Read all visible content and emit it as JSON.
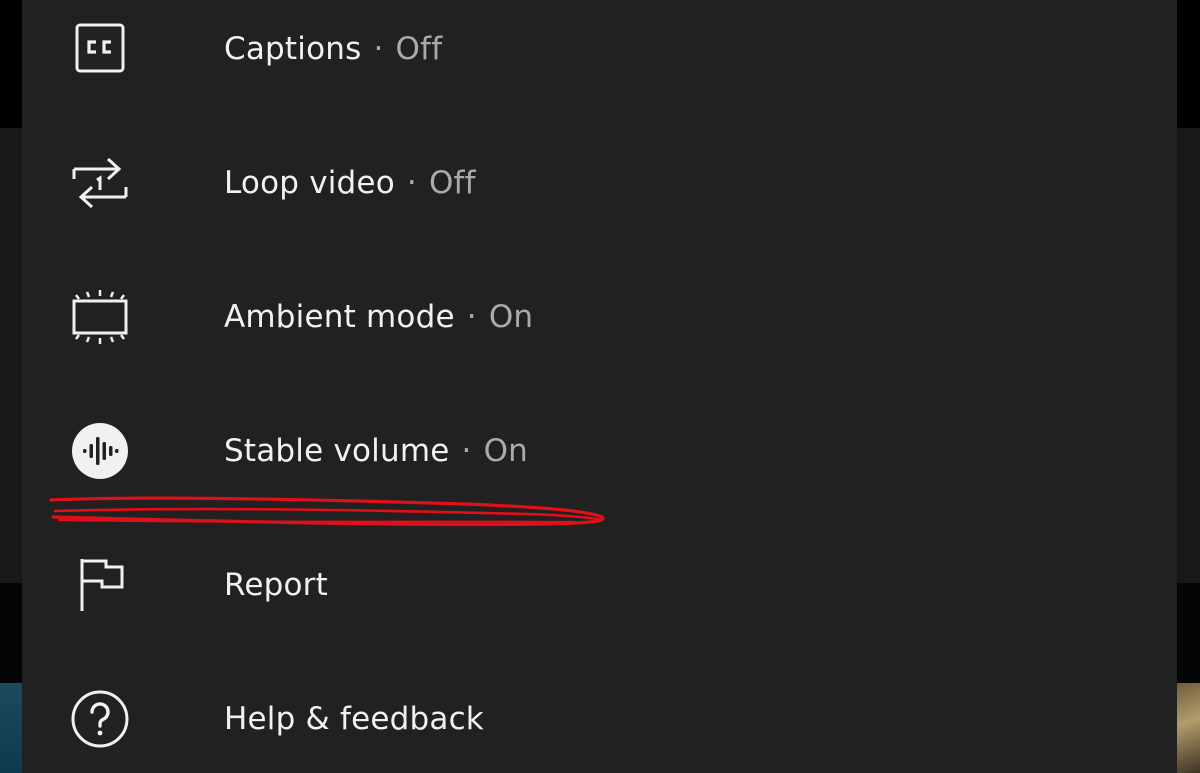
{
  "menu": {
    "items": [
      {
        "icon": "captions-icon",
        "label": "Captions",
        "separator": "·",
        "state": "Off"
      },
      {
        "icon": "loop-icon",
        "label": "Loop video",
        "separator": "·",
        "state": "Off"
      },
      {
        "icon": "ambient-mode-icon",
        "label": "Ambient mode",
        "separator": "·",
        "state": "On"
      },
      {
        "icon": "stable-volume-icon",
        "label": "Stable volume",
        "separator": "·",
        "state": "On"
      },
      {
        "icon": "flag-icon",
        "label": "Report"
      },
      {
        "icon": "help-icon",
        "label": "Help & feedback"
      }
    ]
  },
  "annotation": {
    "color": "#e0101a",
    "marks": "Stable volume"
  },
  "colors": {
    "sheet_background": "#212121",
    "text_primary": "#f1f1f1",
    "text_secondary": "#aaaaaa"
  }
}
